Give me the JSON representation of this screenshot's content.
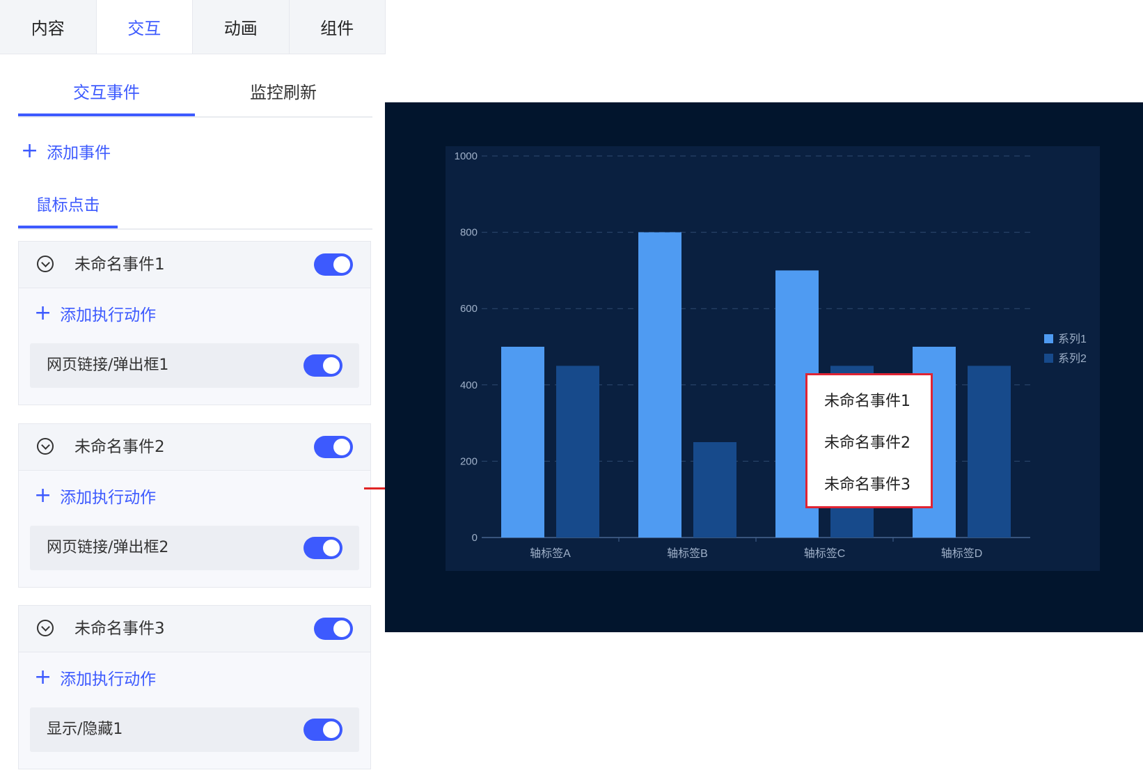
{
  "top_tabs": [
    "内容",
    "交互",
    "动画",
    "组件"
  ],
  "sub_tabs": [
    "交互事件",
    "监控刷新"
  ],
  "add_event_label": "添加事件",
  "trigger_tab": "鼠标点击",
  "events": [
    {
      "name": "未命名事件1",
      "enabled": true,
      "add_action_label": "添加执行动作",
      "action": {
        "label": "网页链接/弹出框1",
        "enabled": true
      }
    },
    {
      "name": "未命名事件2",
      "enabled": true,
      "add_action_label": "添加执行动作",
      "action": {
        "label": "网页链接/弹出框2",
        "enabled": true
      }
    },
    {
      "name": "未命名事件3",
      "enabled": true,
      "add_action_label": "添加执行动作",
      "action": {
        "label": "显示/隐藏1",
        "enabled": true
      }
    }
  ],
  "context_menu": [
    "未命名事件1",
    "未命名事件2",
    "未命名事件3"
  ],
  "colors": {
    "accent": "#3d5afe",
    "series1": "#4f9bf2",
    "series2": "#174a8b",
    "highlight": "#e02433"
  },
  "chart_data": {
    "type": "bar",
    "categories": [
      "轴标签A",
      "轴标签B",
      "轴标签C",
      "轴标签D"
    ],
    "series": [
      {
        "name": "系列1",
        "values": [
          500,
          800,
          700,
          500
        ]
      },
      {
        "name": "系列2",
        "values": [
          450,
          250,
          450,
          450
        ]
      }
    ],
    "y_ticks": [
      "0",
      "200",
      "400",
      "600",
      "800",
      "1000"
    ],
    "ylim": [
      0,
      1000
    ],
    "grid": "horizontal dashed",
    "legend_position": "right"
  }
}
